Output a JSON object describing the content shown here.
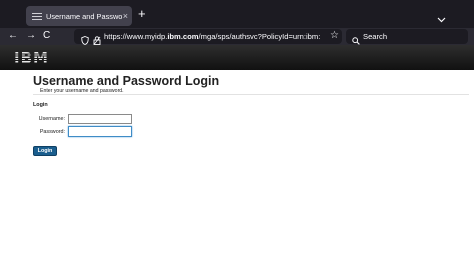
{
  "browser": {
    "tab": {
      "title": "Username and Password",
      "close_glyph": "×",
      "favicon": "page-lines-icon"
    },
    "new_tab_glyph": "+",
    "nav": {
      "back_glyph": "←",
      "forward_glyph": "→",
      "reload_glyph": "C"
    },
    "url": {
      "prefix": "https://www.myidp.",
      "domain": "ibm.com",
      "suffix": "/mga/sps/authsvc?PolicyId=urn:ibm:"
    },
    "bookmark_glyph": "☆",
    "search": {
      "placeholder": "Search"
    },
    "colors": {
      "tabbar": "#1c1b22",
      "toolbar": "#2b2a33",
      "tab": "#42414d"
    }
  },
  "page": {
    "logo_text": "IBM",
    "title": "Username and Password Login",
    "subtitle": "Enter your username and password.",
    "form": {
      "heading": "Login",
      "username_label": "Username:",
      "username_value": "",
      "password_label": "Password:",
      "password_value": "",
      "submit_label": "Login"
    },
    "colors": {
      "header": "#1e1e1e",
      "button": "#1a5e8e",
      "focus_border": "#3f8cc6"
    }
  }
}
